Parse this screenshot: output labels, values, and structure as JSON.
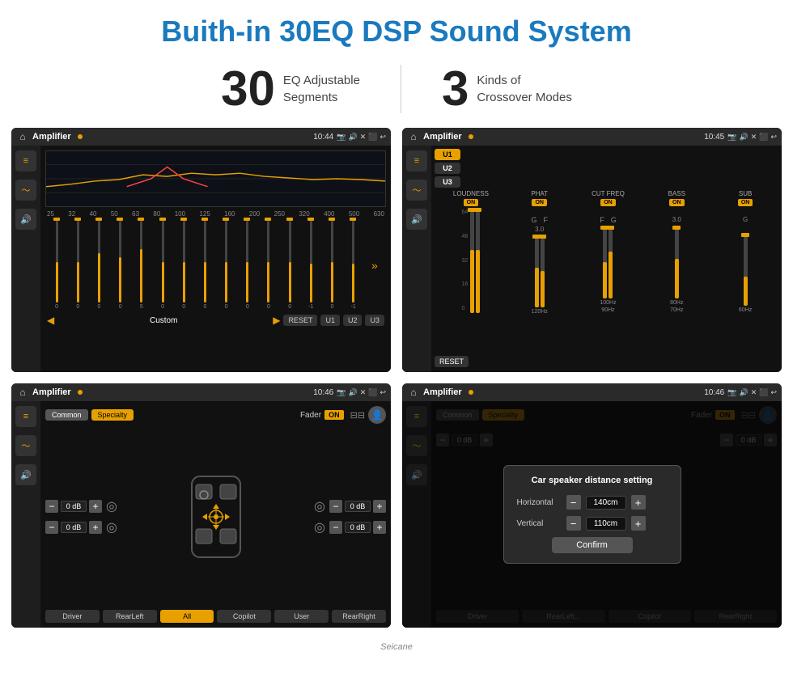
{
  "page": {
    "title": "Buith-in 30EQ DSP Sound System",
    "stats": [
      {
        "number": "30",
        "label": "EQ Adjustable\nSegments"
      },
      {
        "number": "3",
        "label": "Kinds of\nCrossover Modes"
      }
    ]
  },
  "screen1": {
    "title": "Amplifier",
    "time": "10:44",
    "eq_frequencies": [
      "25",
      "32",
      "40",
      "50",
      "63",
      "80",
      "100",
      "125",
      "160",
      "200",
      "250",
      "320",
      "400",
      "500",
      "630"
    ],
    "bottom_buttons": [
      "RESET",
      "U1",
      "U2",
      "U3"
    ],
    "custom_label": "Custom"
  },
  "screen2": {
    "title": "Amplifier",
    "time": "10:45",
    "modes": [
      {
        "id": "U1",
        "active": true
      },
      {
        "id": "U2",
        "active": false
      },
      {
        "id": "U3",
        "active": false
      }
    ],
    "channels": [
      {
        "name": "LOUDNESS",
        "on": true
      },
      {
        "name": "PHAT",
        "on": true
      },
      {
        "name": "CUT FREQ",
        "on": true
      },
      {
        "name": "BASS",
        "on": true
      },
      {
        "name": "SUB",
        "on": true
      }
    ],
    "reset_label": "RESET"
  },
  "screen3": {
    "title": "Amplifier",
    "time": "10:46",
    "tabs": [
      "Common",
      "Specialty"
    ],
    "active_tab": "Specialty",
    "fader_label": "Fader",
    "on_label": "ON",
    "controls": [
      {
        "label": "0 dB"
      },
      {
        "label": "0 dB"
      },
      {
        "label": "0 dB"
      },
      {
        "label": "0 dB"
      }
    ],
    "locations": [
      "Driver",
      "RearLeft",
      "All",
      "Copilot",
      "User",
      "RearRight"
    ]
  },
  "screen4": {
    "title": "Amplifier",
    "time": "10:46",
    "tabs": [
      "Common",
      "Specialty"
    ],
    "active_tab": "Specialty",
    "dialog": {
      "title": "Car speaker distance setting",
      "horizontal_label": "Horizontal",
      "horizontal_value": "140cm",
      "vertical_label": "Vertical",
      "vertical_value": "110cm",
      "confirm_label": "Confirm"
    },
    "controls": [
      {
        "label": "0 dB"
      },
      {
        "label": "0 dB"
      }
    ],
    "locations": [
      "Driver",
      "RearLeft",
      "Copilot",
      "RearRight"
    ]
  },
  "watermark": "Seicane"
}
